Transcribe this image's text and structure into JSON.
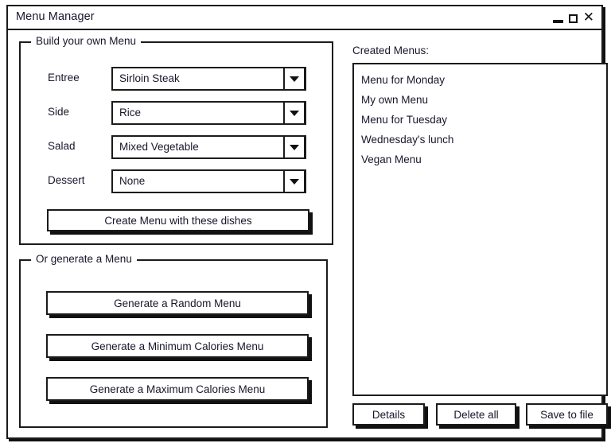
{
  "window": {
    "title": "Menu Manager",
    "controls": {
      "minimize": "minimize",
      "maximize": "maximize",
      "close": "✕"
    }
  },
  "build_group": {
    "legend": "Build your own Menu",
    "fields": [
      {
        "label": "Entree",
        "value": "Sirloin Steak"
      },
      {
        "label": "Side",
        "value": "Rice"
      },
      {
        "label": "Salad",
        "value": "Mixed Vegetable"
      },
      {
        "label": "Dessert",
        "value": "None"
      }
    ],
    "create_button": "Create Menu with these dishes"
  },
  "generate_group": {
    "legend": "Or generate a Menu",
    "buttons": [
      "Generate a Random Menu",
      "Generate a Minimum Calories Menu",
      "Generate a Maximum Calories Menu"
    ]
  },
  "created_menus": {
    "label": "Created Menus:",
    "items": [
      "Menu for Monday",
      "My own Menu",
      "Menu for Tuesday",
      "Wednesday's lunch",
      "Vegan Menu"
    ],
    "actions": {
      "details": "Details",
      "delete_all": "Delete all",
      "save_to_file": "Save to file"
    }
  },
  "colors": {
    "ink": "#1b1b1b",
    "text": "#17172b",
    "surface": "#ffffff"
  }
}
